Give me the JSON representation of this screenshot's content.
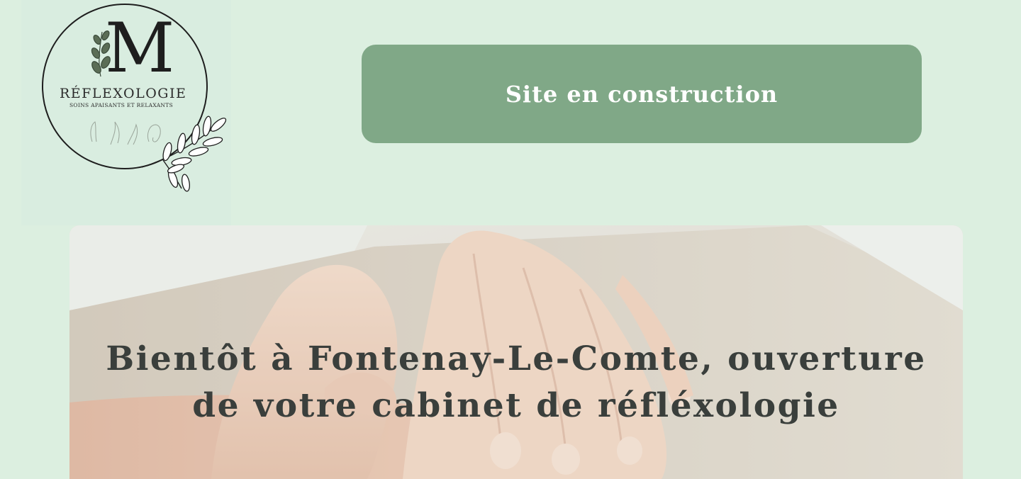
{
  "logo": {
    "letter": "M",
    "brand": "RÉFLEXOLOGIE",
    "tagline": "SOINS APAISANTS ET RELAXANTS"
  },
  "banner": {
    "label": "Site en construction"
  },
  "hero": {
    "title": "Bientôt à Fontenay-Le-Comte, ouverture de votre cabinet de réfléxologie"
  },
  "colors": {
    "page_background": "#dcefe0",
    "banner_background": "#80a887",
    "banner_text": "#ffffff",
    "hero_title": "#3a3f3c"
  }
}
